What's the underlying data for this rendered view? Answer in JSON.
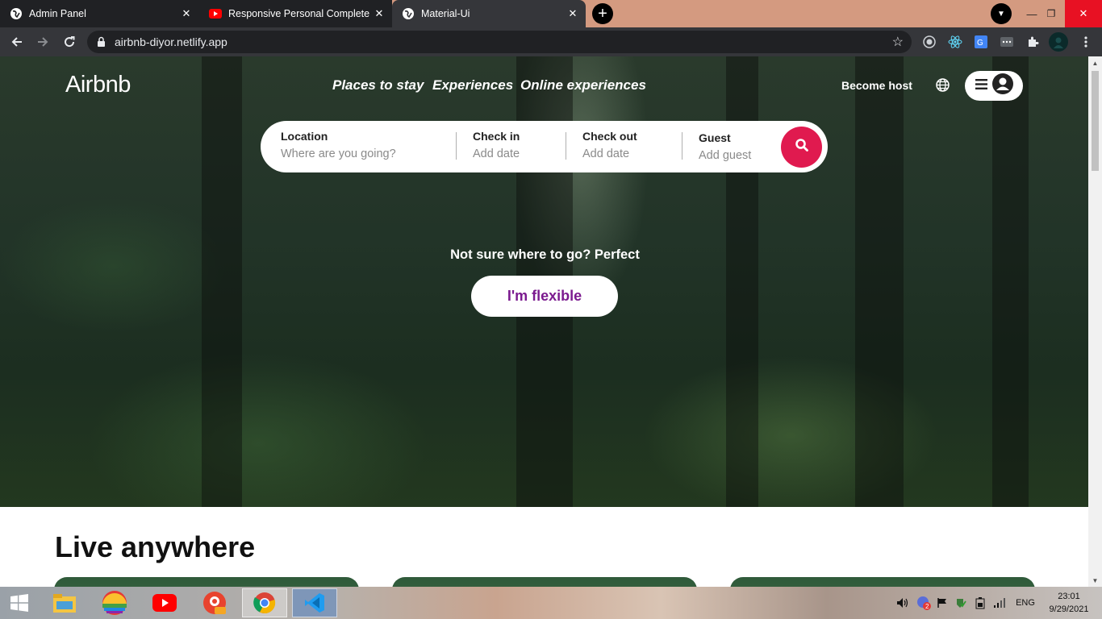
{
  "browser": {
    "tabs": [
      {
        "title": "Admin Panel",
        "icon": "globe-icon"
      },
      {
        "title": "Responsive Personal Complete Po",
        "icon": "youtube-icon"
      },
      {
        "title": "Material-Ui",
        "icon": "globe-icon"
      }
    ],
    "url": "airbnb-diyor.netlify.app"
  },
  "page": {
    "logo": "Airbnb",
    "nav": [
      "Places to stay",
      "Experiences",
      "Online experiences"
    ],
    "become_host": "Become host",
    "search": {
      "location_label": "Location",
      "location_placeholder": "Where are you going?",
      "checkin_label": "Check in",
      "checkin_placeholder": "Add date",
      "checkout_label": "Check out",
      "checkout_placeholder": "Add date",
      "guest_label": "Guest",
      "guest_placeholder": "Add guest"
    },
    "hero_text": "Not sure where to go? Perfect",
    "flexible_button": "I'm flexible",
    "section_title": "Live anywhere",
    "colors": {
      "search_button": "#e01a4f",
      "flexible_text": "#7b1a8f"
    }
  },
  "taskbar": {
    "apps": [
      "file-explorer-icon",
      "google-photos-icon",
      "youtube-icon",
      "photo-editor-icon",
      "chrome-icon",
      "vscode-icon"
    ],
    "language": "ENG",
    "time": "23:01",
    "date": "9/29/2021",
    "notification_count": "2"
  }
}
